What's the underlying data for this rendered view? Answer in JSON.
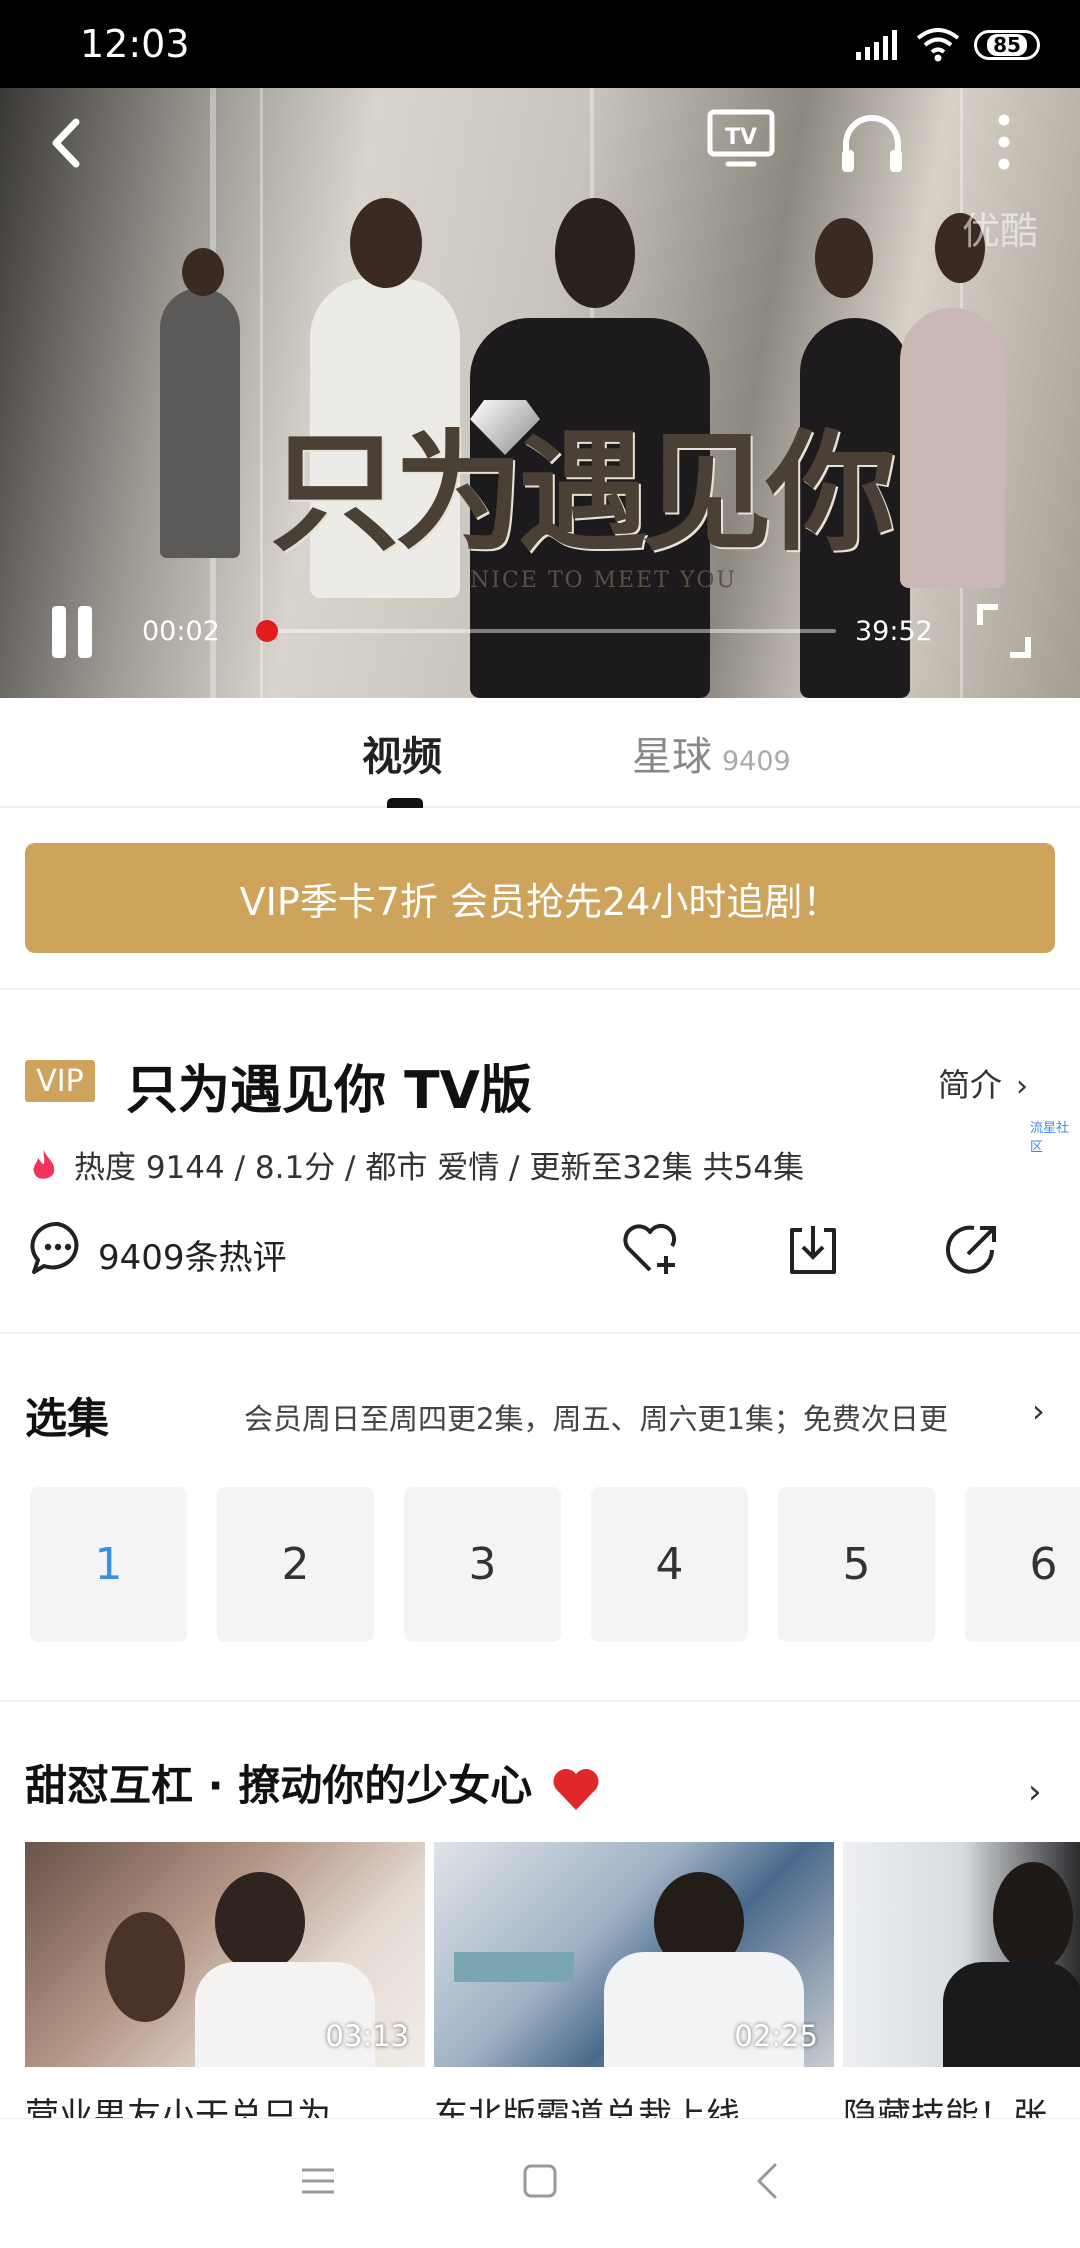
{
  "status_bar": {
    "time": "12:03",
    "battery": "85"
  },
  "player": {
    "current_time": "00:02",
    "total_time": "39:52",
    "progress": 0.001,
    "watermark": "优酷",
    "poster_title": "只为遇见你",
    "poster_subtitle": "NICE TO MEET YOU",
    "accent_color": "#e41b1b"
  },
  "tabs": [
    {
      "label": "视频"
    },
    {
      "label": "星球",
      "count": "9409"
    }
  ],
  "banner": {
    "text": "VIP季卡7折 会员抢先24小时追剧！",
    "color": "#cea35b"
  },
  "show": {
    "badge": "VIP",
    "title": "只为遇见你  TV版",
    "intro_label": "简介",
    "community_tag": "流星社区",
    "meta": "热度 9144 / 8.1分 / 都市 爱情 / 更新至32集 共54集",
    "comments": "9409条热评"
  },
  "episodes": {
    "header": "选集",
    "note": "会员周日至周四更2集，周五、周六更1集；免费次日更",
    "items": [
      "1",
      "2",
      "3",
      "4",
      "5",
      "6"
    ],
    "selected": "1",
    "selected_color": "#3a8ee6"
  },
  "recommend": {
    "title": "甜怼互杠 · 撩动你的少女心",
    "items": [
      {
        "duration": "03:13",
        "caption": "营业男友小干总只为"
      },
      {
        "duration": "02:25",
        "caption": "东北版霸道总裁上线"
      },
      {
        "duration": "",
        "caption": "隐藏技能！张"
      }
    ]
  },
  "icons": [
    "back-icon",
    "tv-cast-icon",
    "headphones-icon",
    "more-icon",
    "pause-icon",
    "fullscreen-icon",
    "flame-icon",
    "comment-icon",
    "favorite-add-icon",
    "download-icon",
    "share-icon",
    "chevron-right-icon",
    "heart-icon",
    "menu-icon",
    "home-icon",
    "back-nav-icon"
  ]
}
